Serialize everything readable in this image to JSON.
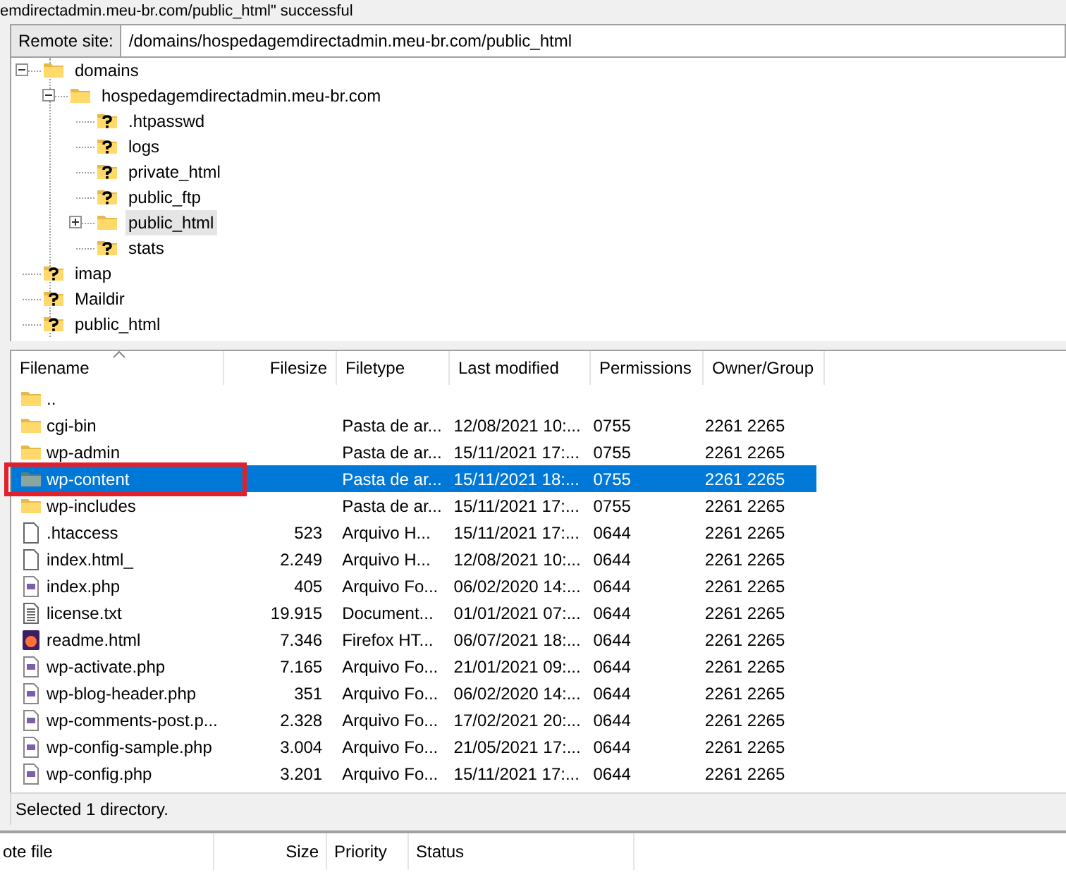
{
  "log_line": "emdirectadmin.meu-br.com/public_html\" successful",
  "remote_site": {
    "label": "Remote site:",
    "value": "/domains/hospedagemdirectadmin.meu-br.com/public_html"
  },
  "tree": [
    {
      "name": "domains",
      "kind": "folder",
      "expanded": true,
      "selected": false,
      "children": [
        {
          "name": "hospedagemdirectadmin.meu-br.com",
          "kind": "folder",
          "expanded": true,
          "selected": false,
          "children": [
            {
              "name": ".htpasswd",
              "kind": "unknown",
              "selected": false
            },
            {
              "name": "logs",
              "kind": "unknown",
              "selected": false
            },
            {
              "name": "private_html",
              "kind": "unknown",
              "selected": false
            },
            {
              "name": "public_ftp",
              "kind": "unknown",
              "selected": false
            },
            {
              "name": "public_html",
              "kind": "folder",
              "expanded": false,
              "selected": true
            },
            {
              "name": "stats",
              "kind": "unknown",
              "selected": false
            }
          ]
        }
      ]
    },
    {
      "name": "imap",
      "kind": "unknown",
      "selected": false
    },
    {
      "name": "Maildir",
      "kind": "unknown",
      "selected": false
    },
    {
      "name": "public_html",
      "kind": "unknown",
      "selected": false
    }
  ],
  "file_list": {
    "columns": [
      "Filename",
      "Filesize",
      "Filetype",
      "Last modified",
      "Permissions",
      "Owner/Group"
    ],
    "rows": [
      {
        "kind": "folder",
        "name": "..",
        "selected": false,
        "highlighted": false
      },
      {
        "kind": "folder",
        "name": "cgi-bin",
        "type": "Pasta de ar...",
        "modified": "12/08/2021 10:...",
        "permissions": "0755",
        "owner": "2261 2265",
        "selected": false,
        "highlighted": false
      },
      {
        "kind": "folder",
        "name": "wp-admin",
        "type": "Pasta de ar...",
        "modified": "15/11/2021 17:...",
        "permissions": "0755",
        "owner": "2261 2265",
        "selected": false,
        "highlighted": false
      },
      {
        "kind": "folder",
        "name": "wp-content",
        "type": "Pasta de ar...",
        "modified": "15/11/2021 18:...",
        "permissions": "0755",
        "owner": "2261 2265",
        "selected": true,
        "highlighted": true
      },
      {
        "kind": "folder",
        "name": "wp-includes",
        "type": "Pasta de ar...",
        "modified": "15/11/2021 17:...",
        "permissions": "0755",
        "owner": "2261 2265",
        "selected": false,
        "highlighted": false
      },
      {
        "kind": "file",
        "name": ".htaccess",
        "size": "523",
        "type": "Arquivo H...",
        "modified": "15/11/2021 17:...",
        "permissions": "0644",
        "owner": "2261 2265",
        "selected": false,
        "highlighted": false
      },
      {
        "kind": "file",
        "name": "index.html_",
        "size": "2.249",
        "type": "Arquivo H...",
        "modified": "12/08/2021 10:...",
        "permissions": "0644",
        "owner": "2261 2265",
        "selected": false,
        "highlighted": false
      },
      {
        "kind": "php",
        "name": "index.php",
        "size": "405",
        "type": "Arquivo Fo...",
        "modified": "06/02/2020 14:...",
        "permissions": "0644",
        "owner": "2261 2265",
        "selected": false,
        "highlighted": false
      },
      {
        "kind": "text",
        "name": "license.txt",
        "size": "19.915",
        "type": "Document...",
        "modified": "01/01/2021 07:...",
        "permissions": "0644",
        "owner": "2261 2265",
        "selected": false,
        "highlighted": false
      },
      {
        "kind": "browser",
        "name": "readme.html",
        "size": "7.346",
        "type": "Firefox HT...",
        "modified": "06/07/2021 18:...",
        "permissions": "0644",
        "owner": "2261 2265",
        "selected": false,
        "highlighted": false
      },
      {
        "kind": "php",
        "name": "wp-activate.php",
        "size": "7.165",
        "type": "Arquivo Fo...",
        "modified": "21/01/2021 09:...",
        "permissions": "0644",
        "owner": "2261 2265",
        "selected": false,
        "highlighted": false
      },
      {
        "kind": "php",
        "name": "wp-blog-header.php",
        "size": "351",
        "type": "Arquivo Fo...",
        "modified": "06/02/2020 14:...",
        "permissions": "0644",
        "owner": "2261 2265",
        "selected": false,
        "highlighted": false
      },
      {
        "kind": "php",
        "name": "wp-comments-post.p...",
        "size": "2.328",
        "type": "Arquivo Fo...",
        "modified": "17/02/2021 20:...",
        "permissions": "0644",
        "owner": "2261 2265",
        "selected": false,
        "highlighted": false
      },
      {
        "kind": "php",
        "name": "wp-config-sample.php",
        "size": "3.004",
        "type": "Arquivo Fo...",
        "modified": "21/05/2021 17:...",
        "permissions": "0644",
        "owner": "2261 2265",
        "selected": false,
        "highlighted": false
      },
      {
        "kind": "php",
        "name": "wp-config.php",
        "size": "3.201",
        "type": "Arquivo Fo...",
        "modified": "15/11/2021 17:...",
        "permissions": "0644",
        "owner": "2261 2265",
        "selected": false,
        "highlighted": false
      }
    ]
  },
  "status_bar": "Selected 1 directory.",
  "queue": {
    "columns": [
      "ote file",
      "Size",
      "Priority",
      "Status"
    ]
  }
}
